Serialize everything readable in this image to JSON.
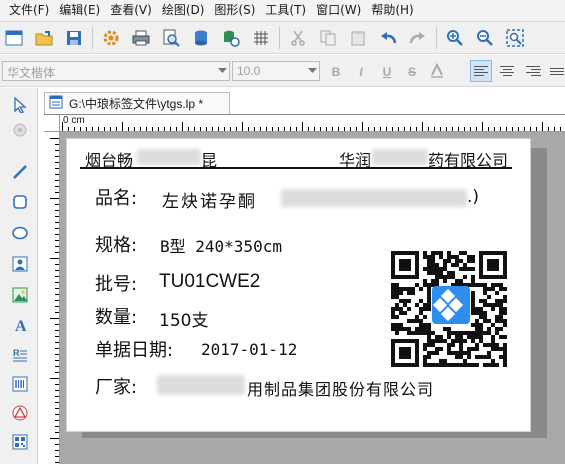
{
  "menubar": {
    "items": [
      "文件(F)",
      "编辑(E)",
      "查看(V)",
      "绘图(D)",
      "图形(S)",
      "工具(T)",
      "窗口(W)",
      "帮助(H)"
    ]
  },
  "toolbar": {
    "icons": [
      "new-file-icon",
      "open-folder-icon",
      "save-icon",
      "settings-gear-icon",
      "print-icon",
      "print-preview-icon",
      "database-icon",
      "database-link-icon",
      "grid-icon",
      "cut-icon",
      "copy-icon",
      "paste-icon",
      "undo-icon",
      "redo-icon",
      "zoom-in-icon",
      "zoom-out-icon",
      "zoom-fit-icon"
    ]
  },
  "format_bar": {
    "font_name": "华文楷体",
    "font_size": "10.0",
    "bold_label": "B",
    "italic_label": "I",
    "underline_label": "U",
    "strike_label": "S"
  },
  "document": {
    "tab_title": "G:\\中琅标签文件\\ytgs.lp *"
  },
  "ruler": {
    "origin_label": "0 cm"
  },
  "label": {
    "header_left": "烟台畅",
    "header_left_tail": "昆",
    "header_right_pre": "华润",
    "header_right_post": "药有限公司",
    "product_name_label": "品名:",
    "product_name_value": "左炔诺孕酮",
    "product_name_tail": ".)",
    "spec_label": "规格:",
    "spec_value": "B型  240*350cm",
    "batch_label": "批号:",
    "batch_value": "TU01CWE2",
    "quantity_label": "数量:",
    "quantity_value": "150支",
    "date_label": "单据日期:",
    "date_value": "2017-01-12",
    "maker_label": "厂家:",
    "maker_value": "用制品集团股份有限公司"
  },
  "colors": {
    "accent": "#2f6fb8",
    "qr_logo": "#2d8ef0"
  }
}
